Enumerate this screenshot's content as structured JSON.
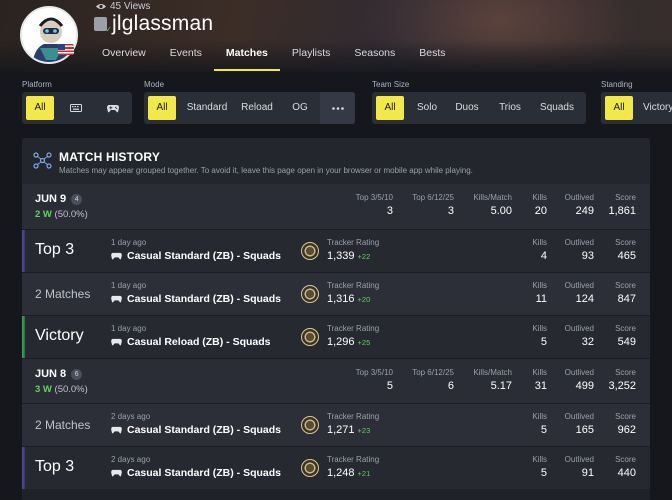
{
  "profile": {
    "views": "45 Views",
    "username": "jlglassman"
  },
  "nav": {
    "tabs": [
      {
        "label": "Overview",
        "active": false
      },
      {
        "label": "Events",
        "active": false
      },
      {
        "label": "Matches",
        "active": true
      },
      {
        "label": "Playlists",
        "active": false
      },
      {
        "label": "Seasons",
        "active": false
      },
      {
        "label": "Bests",
        "active": false
      }
    ]
  },
  "filters": {
    "platform": {
      "label": "Platform",
      "options": [
        "All"
      ],
      "selected": "All"
    },
    "mode": {
      "label": "Mode",
      "options": [
        "All",
        "Standard",
        "Reload",
        "OG"
      ],
      "selected": "All"
    },
    "team_size": {
      "label": "Team Size",
      "options": [
        "All",
        "Solo",
        "Duos",
        "Trios",
        "Squads"
      ],
      "selected": "All"
    },
    "standing": {
      "label": "Standing",
      "options": [
        "All",
        "Victory"
      ],
      "selected": "All"
    }
  },
  "history": {
    "title": "MATCH HISTORY",
    "note": "Matches may appear grouped together. To avoid it, leave this page open in your browser or mobile app while playing."
  },
  "labels": {
    "top3510": "Top 3/5/10",
    "top61225": "Top 6/12/25",
    "kills_per_match": "Kills/Match",
    "kills": "Kills",
    "outlived": "Outlived",
    "score": "Score",
    "tracker_rating": "Tracker Rating"
  },
  "days": [
    {
      "date": "JUN 9",
      "count": "4",
      "wins": "2 W",
      "win_pct": "(50.0%)",
      "top3510": "3",
      "top61225": "3",
      "kills_per_match": "5.00",
      "kills": "20",
      "outlived": "249",
      "score": "1,861"
    },
    {
      "date": "JUN 8",
      "count": "6",
      "wins": "3 W",
      "win_pct": "(50.0%)",
      "top3510": "5",
      "top61225": "6",
      "kills_per_match": "5.17",
      "kills": "31",
      "outlived": "499",
      "score": "3,252"
    }
  ],
  "matches": [
    {
      "placement": "Top 3",
      "time_ago": "1 day ago",
      "mode": "Casual Standard (ZB) - Squads",
      "rating": "1,339",
      "delta": "+22",
      "kills": "4",
      "outlived": "93",
      "score": "465"
    },
    {
      "placement": "2 Matches",
      "time_ago": "1 day ago",
      "mode": "Casual Standard (ZB) - Squads",
      "rating": "1,316",
      "delta": "+20",
      "kills": "11",
      "outlived": "124",
      "score": "847"
    },
    {
      "placement": "Victory",
      "time_ago": "1 day ago",
      "mode": "Casual Reload (ZB) - Squads",
      "rating": "1,296",
      "delta": "+25",
      "kills": "5",
      "outlived": "32",
      "score": "549"
    },
    {
      "placement": "2 Matches",
      "time_ago": "2 days ago",
      "mode": "Casual Standard (ZB) - Squads",
      "rating": "1,271",
      "delta": "+23",
      "kills": "5",
      "outlived": "165",
      "score": "962"
    },
    {
      "placement": "Top 3",
      "time_ago": "2 days ago",
      "mode": "Casual Standard (ZB) - Squads",
      "rating": "1,248",
      "delta": "+21",
      "kills": "5",
      "outlived": "91",
      "score": "440"
    }
  ],
  "colors": {
    "accent_yellow": "#f2e84a",
    "top3_purple": "#5a4aa8",
    "victory_green": "#36b25a",
    "positive_green": "#5fd35f"
  },
  "icons": {
    "views": "eye-icon",
    "platform_badge": "epic-games-icon",
    "history": "match-history-icon",
    "controller": "gamepad-icon",
    "keyboard": "keyboard-icon",
    "more": "ellipsis-icon"
  }
}
